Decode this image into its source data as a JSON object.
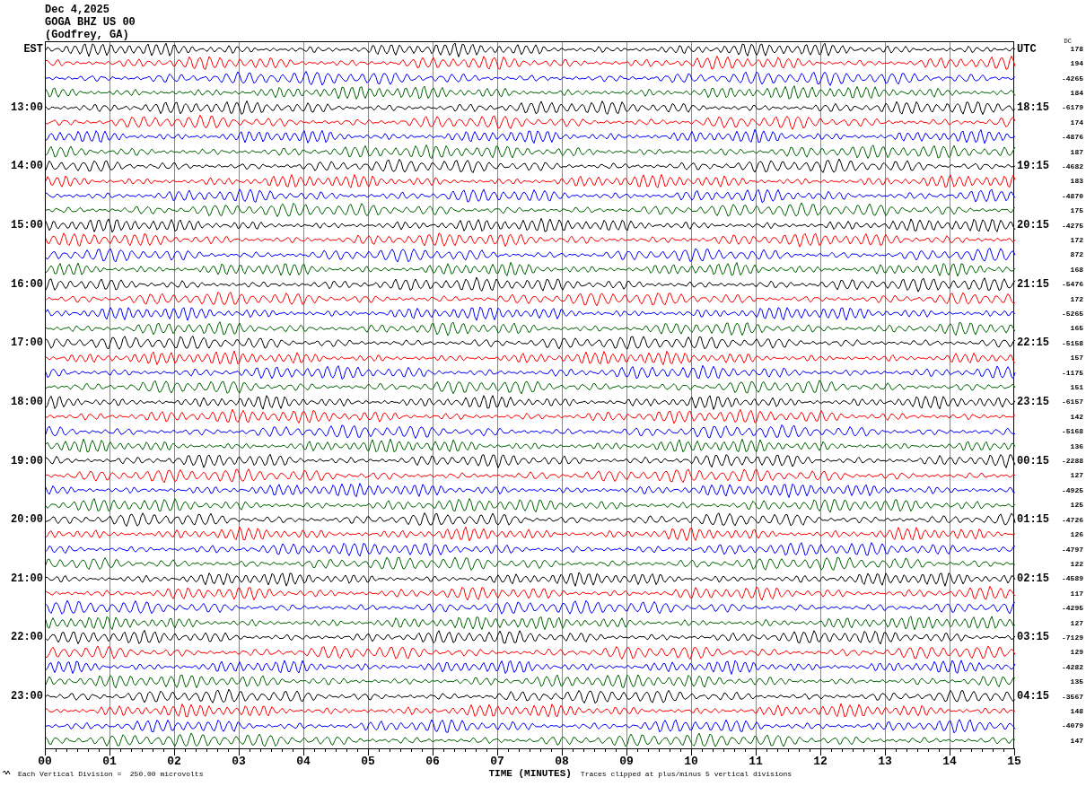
{
  "header": {
    "date": "Dec 4,2025",
    "station": "GOGA BHZ US 00",
    "location": "(Godfrey, GA)"
  },
  "left_header": "EST",
  "right_header": "UTC",
  "dc_header": "DC",
  "hours": [
    {
      "traces": [
        {
          "color": "#000000",
          "dc": "178"
        },
        {
          "color": "#ff0000",
          "dc": "194"
        },
        {
          "color": "#0000ff",
          "dc": "-4265"
        },
        {
          "color": "#006400",
          "dc": "184"
        }
      ]
    },
    {
      "est": "13:00",
      "utc": "18:15",
      "traces": [
        {
          "color": "#000000",
          "dc": "-6179"
        },
        {
          "color": "#ff0000",
          "dc": "174"
        },
        {
          "color": "#0000ff",
          "dc": "-4876"
        },
        {
          "color": "#006400",
          "dc": "187"
        }
      ]
    },
    {
      "est": "14:00",
      "utc": "19:15",
      "traces": [
        {
          "color": "#000000",
          "dc": "-4682"
        },
        {
          "color": "#ff0000",
          "dc": "183"
        },
        {
          "color": "#0000ff",
          "dc": "-4870"
        },
        {
          "color": "#006400",
          "dc": "175"
        }
      ]
    },
    {
      "est": "15:00",
      "utc": "20:15",
      "traces": [
        {
          "color": "#000000",
          "dc": "-4275"
        },
        {
          "color": "#ff0000",
          "dc": "172"
        },
        {
          "color": "#0000ff",
          "dc": "872"
        },
        {
          "color": "#006400",
          "dc": "168"
        }
      ]
    },
    {
      "est": "16:00",
      "utc": "21:15",
      "traces": [
        {
          "color": "#000000",
          "dc": "-5476"
        },
        {
          "color": "#ff0000",
          "dc": "172"
        },
        {
          "color": "#0000ff",
          "dc": "-5265"
        },
        {
          "color": "#006400",
          "dc": "165"
        }
      ]
    },
    {
      "est": "17:00",
      "utc": "22:15",
      "traces": [
        {
          "color": "#000000",
          "dc": "-5158"
        },
        {
          "color": "#ff0000",
          "dc": "157"
        },
        {
          "color": "#0000ff",
          "dc": "-1175"
        },
        {
          "color": "#006400",
          "dc": "151"
        }
      ]
    },
    {
      "est": "18:00",
      "utc": "23:15",
      "traces": [
        {
          "color": "#000000",
          "dc": "-6157"
        },
        {
          "color": "#ff0000",
          "dc": "142"
        },
        {
          "color": "#0000ff",
          "dc": "-5168"
        },
        {
          "color": "#006400",
          "dc": "136"
        }
      ]
    },
    {
      "est": "19:00",
      "utc": "00:15",
      "traces": [
        {
          "color": "#000000",
          "dc": "-2288"
        },
        {
          "color": "#ff0000",
          "dc": "127"
        },
        {
          "color": "#0000ff",
          "dc": "-4925"
        },
        {
          "color": "#006400",
          "dc": "125"
        }
      ]
    },
    {
      "est": "20:00",
      "utc": "01:15",
      "traces": [
        {
          "color": "#000000",
          "dc": "-4726"
        },
        {
          "color": "#ff0000",
          "dc": "126"
        },
        {
          "color": "#0000ff",
          "dc": "-4797"
        },
        {
          "color": "#006400",
          "dc": "122"
        }
      ]
    },
    {
      "est": "21:00",
      "utc": "02:15",
      "traces": [
        {
          "color": "#000000",
          "dc": "-4589"
        },
        {
          "color": "#ff0000",
          "dc": "117"
        },
        {
          "color": "#0000ff",
          "dc": "-4295"
        },
        {
          "color": "#006400",
          "dc": "127"
        }
      ]
    },
    {
      "est": "22:00",
      "utc": "03:15",
      "traces": [
        {
          "color": "#000000",
          "dc": "-7129"
        },
        {
          "color": "#ff0000",
          "dc": "129"
        },
        {
          "color": "#0000ff",
          "dc": "-4282"
        },
        {
          "color": "#006400",
          "dc": "135"
        }
      ]
    },
    {
      "est": "23:00",
      "utc": "04:15",
      "traces": [
        {
          "color": "#000000",
          "dc": "-3567"
        },
        {
          "color": "#ff0000",
          "dc": "148"
        },
        {
          "color": "#0000ff",
          "dc": "-4079"
        },
        {
          "color": "#006400",
          "dc": "147"
        }
      ]
    }
  ],
  "time_axis": {
    "ticks": [
      "00",
      "01",
      "02",
      "03",
      "04",
      "05",
      "06",
      "07",
      "08",
      "09",
      "10",
      "11",
      "12",
      "13",
      "14",
      "15"
    ],
    "title": "TIME (MINUTES)"
  },
  "footer": {
    "scale_note": "Each Vertical Division =  250.00 microvolts",
    "clip_note": "Traces clipped at plus/minus 5 vertical divisions"
  }
}
